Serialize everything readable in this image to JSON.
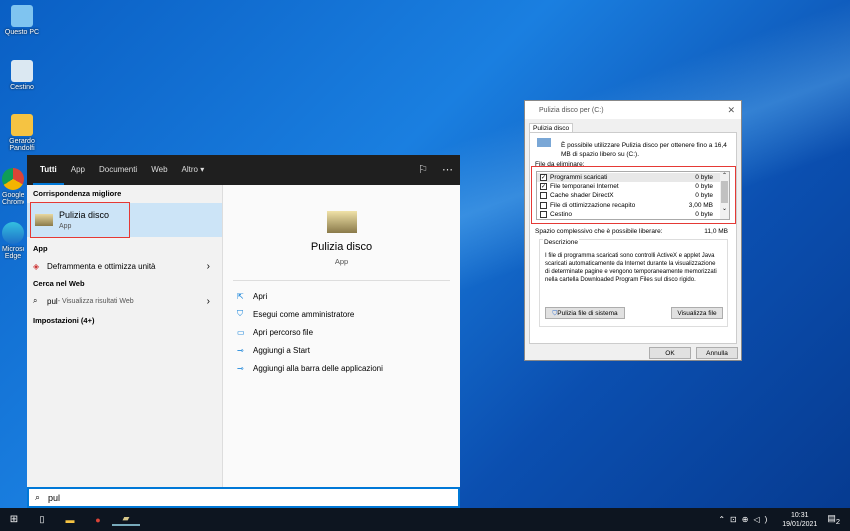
{
  "desktop": {
    "icons": [
      "Questo PC",
      "Cestino",
      "Gerardo Pandolfi",
      "Google Chrome",
      "Microsoft Edge"
    ]
  },
  "start": {
    "tabs": [
      "Tutti",
      "App",
      "Documenti",
      "Web",
      "Altro"
    ],
    "best_match_header": "Corrispondenza migliore",
    "best_match": {
      "name": "Pulizia disco",
      "type": "App"
    },
    "app_header": "App",
    "apps": [
      "Deframmenta e ottimizza unità"
    ],
    "web_header": "Cerca nel Web",
    "web_query": "pul",
    "web_hint": " - Visualizza risultati Web",
    "settings_header": "Impostazioni (4+)",
    "detail": {
      "name": "Pulizia disco",
      "type": "App"
    },
    "actions": [
      "Apri",
      "Esegui come amministratore",
      "Apri percorso file",
      "Aggiungi a Start",
      "Aggiungi alla barra delle applicazioni"
    ],
    "search_value": "pul"
  },
  "dialog": {
    "title": "Pulizia disco per  (C:)",
    "tab": "Pulizia disco",
    "intro": "È possibile utilizzare Pulizia disco per ottenere fino a 16,4 MB di spazio libero su  (C:).",
    "files_label": "File da eliminare:",
    "files": [
      {
        "name": "Programmi scaricati",
        "size": "0 byte",
        "checked": true
      },
      {
        "name": "File temporanei Internet",
        "size": "0 byte",
        "checked": true
      },
      {
        "name": "Cache shader DirectX",
        "size": "0 byte",
        "checked": false
      },
      {
        "name": "File di ottimizzazione recapito",
        "size": "3,00 MB",
        "checked": false
      },
      {
        "name": "Cestino",
        "size": "0 byte",
        "checked": false
      }
    ],
    "total_label": "Spazio complessivo che è possibile liberare:",
    "total_value": "11,0 MB",
    "desc_label": "Descrizione",
    "desc": "I file di programma scaricati sono controlli ActiveX e applet Java scaricati automaticamente da Internet durante la visualizzazione di determinate pagine e vengono temporaneamente memorizzati nella cartella Downloaded Program Files sul disco rigido.",
    "system_btn": "Pulizia file di sistema",
    "view_btn": "Visualizza file",
    "ok": "OK",
    "cancel": "Annulla"
  },
  "taskbar": {
    "time": "10:31",
    "date": "19/01/2021",
    "notifications": "2"
  }
}
